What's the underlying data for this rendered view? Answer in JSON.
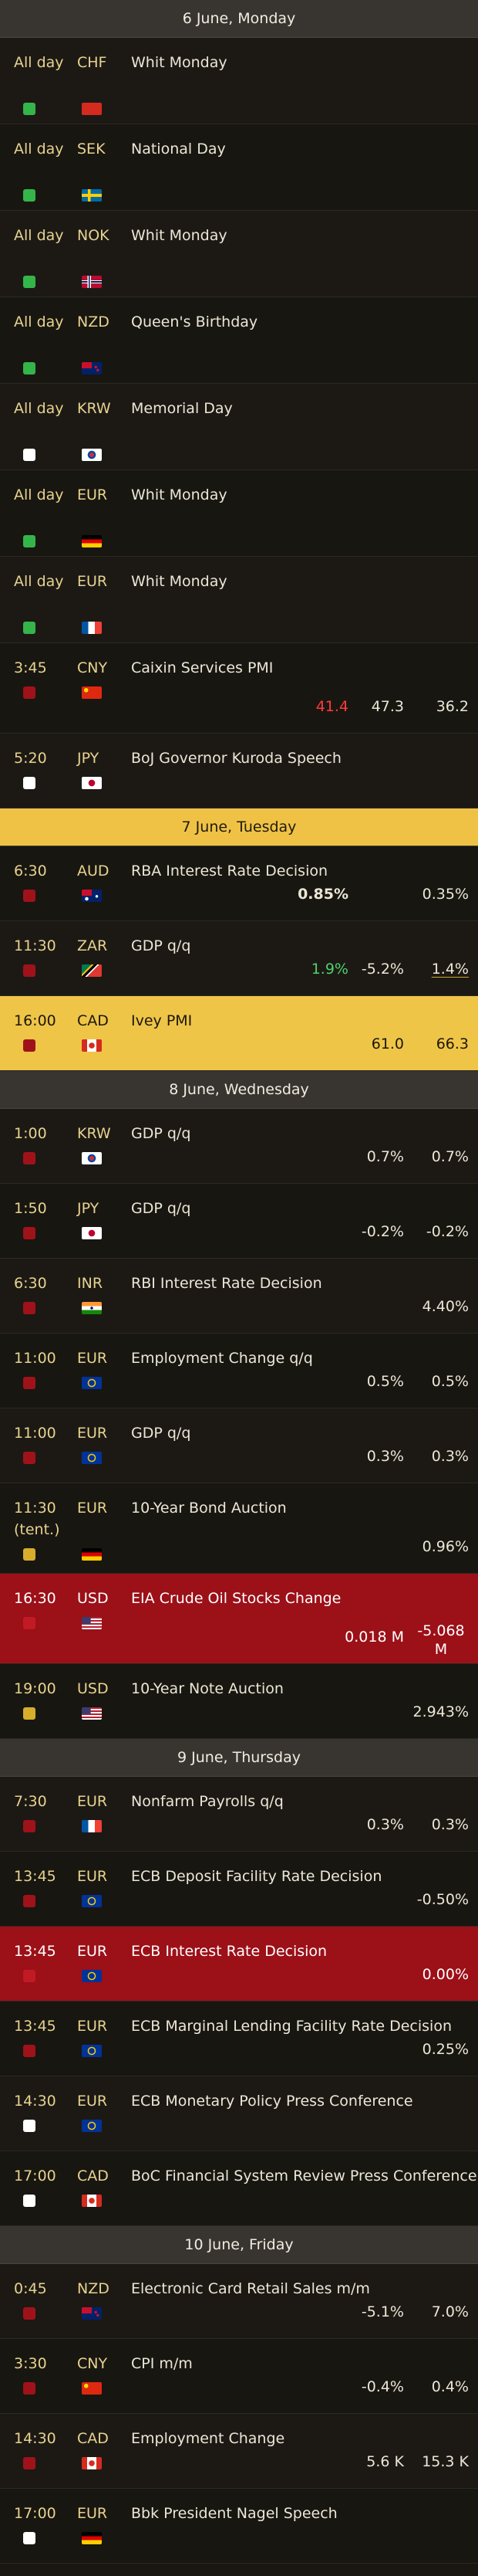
{
  "days": [
    {
      "label": "6 June, Monday",
      "highlight": false,
      "events": [
        {
          "time": "All day",
          "ccy": "CHF",
          "flag": "ch",
          "imp": "green",
          "title": "Whit Monday",
          "h": 111
        },
        {
          "time": "All day",
          "ccy": "SEK",
          "flag": "se",
          "imp": "green",
          "title": "National Day",
          "h": 111
        },
        {
          "time": "All day",
          "ccy": "NOK",
          "flag": "no",
          "imp": "green",
          "title": "Whit Monday",
          "h": 111
        },
        {
          "time": "All day",
          "ccy": "NZD",
          "flag": "nz",
          "imp": "green",
          "title": "Queen's Birthday",
          "h": 111
        },
        {
          "time": "All day",
          "ccy": "KRW",
          "flag": "kr",
          "imp": "white",
          "title": "Memorial Day",
          "h": 111
        },
        {
          "time": "All day",
          "ccy": "EUR",
          "flag": "de",
          "imp": "green",
          "title": "Whit Monday",
          "h": 111
        },
        {
          "time": "All day",
          "ccy": "EUR",
          "flag": "fr",
          "imp": "green",
          "title": "Whit Monday",
          "h": 111
        },
        {
          "time": "3:45",
          "ccy": "CNY",
          "flag": "cn",
          "imp": "red",
          "title": "Caixin Services PMI",
          "actual": "41.4",
          "actual_color": "neg",
          "forecast": "47.3",
          "previous": "36.2",
          "h": 116
        },
        {
          "time": "5:20",
          "ccy": "JPY",
          "flag": "jp",
          "imp": "white",
          "title": "BoJ Governor Kuroda Speech",
          "h": 96
        }
      ]
    },
    {
      "label": "7 June, Tuesday",
      "highlight": true,
      "events": [
        {
          "time": "6:30",
          "ccy": "AUD",
          "flag": "au",
          "imp": "red",
          "title": "RBA Interest Rate Decision",
          "actual": "0.85%",
          "actual_color": "bold",
          "previous": "0.35%",
          "h": 96
        },
        {
          "time": "11:30",
          "ccy": "ZAR",
          "flag": "za",
          "imp": "red",
          "title": "GDP q/q",
          "actual": "1.9%",
          "actual_color": "pos",
          "forecast": "-5.2%",
          "previous": "1.4%",
          "prev_und": true,
          "h": 96
        },
        {
          "time": "16:00",
          "ccy": "CAD",
          "flag": "ca",
          "imp": "red",
          "title": "Ivey PMI",
          "forecast": "61.0",
          "previous": "66.3",
          "row": "yellow",
          "h": 96
        }
      ]
    },
    {
      "label": "8 June, Wednesday",
      "highlight": false,
      "events": [
        {
          "time": "1:00",
          "ccy": "KRW",
          "flag": "kr",
          "imp": "red",
          "title": "GDP q/q",
          "forecast": "0.7%",
          "previous": "0.7%",
          "h": 96
        },
        {
          "time": "1:50",
          "ccy": "JPY",
          "flag": "jp",
          "imp": "red",
          "title": "GDP q/q",
          "forecast": "-0.2%",
          "previous": "-0.2%",
          "h": 96
        },
        {
          "time": "6:30",
          "ccy": "INR",
          "flag": "in",
          "imp": "red",
          "title": "RBI Interest Rate Decision",
          "previous": "4.40%",
          "h": 96
        },
        {
          "time": "11:00",
          "ccy": "EUR",
          "flag": "eu",
          "imp": "red",
          "title": "Employment Change q/q",
          "forecast": "0.5%",
          "previous": "0.5%",
          "h": 96
        },
        {
          "time": "11:00",
          "ccy": "EUR",
          "flag": "eu",
          "imp": "red",
          "title": "GDP q/q",
          "forecast": "0.3%",
          "previous": "0.3%",
          "h": 96
        },
        {
          "time": "11:30 (tent.)",
          "ccy": "EUR",
          "flag": "de",
          "imp": "yellow",
          "title": "10-Year Bond Auction",
          "previous": "0.96%",
          "h": 116
        },
        {
          "time": "16:30",
          "ccy": "USD",
          "flag": "us",
          "imp": "red",
          "title": "EIA Crude Oil Stocks Change",
          "forecast": "0.018 M",
          "previous": "-5.068 M",
          "row": "red",
          "h": 116
        },
        {
          "time": "19:00",
          "ccy": "USD",
          "flag": "us",
          "imp": "yellow",
          "title": "10-Year Note Auction",
          "previous": "2.943%",
          "h": 96
        }
      ]
    },
    {
      "label": "9 June, Thursday",
      "highlight": false,
      "events": [
        {
          "time": "7:30",
          "ccy": "EUR",
          "flag": "fr",
          "imp": "red",
          "title": "Nonfarm Payrolls q/q",
          "forecast": "0.3%",
          "previous": "0.3%",
          "h": 96
        },
        {
          "time": "13:45",
          "ccy": "EUR",
          "flag": "eu",
          "imp": "red",
          "title": "ECB Deposit Facility Rate Decision",
          "previous": "-0.50%",
          "h": 96
        },
        {
          "time": "13:45",
          "ccy": "EUR",
          "flag": "eu",
          "imp": "red",
          "title": "ECB Interest Rate Decision",
          "previous": "0.00%",
          "row": "red",
          "h": 96
        },
        {
          "time": "13:45",
          "ccy": "EUR",
          "flag": "eu",
          "imp": "red",
          "title": "ECB Marginal Lending Facility Rate Decision",
          "previous": "0.25%",
          "h": 96
        },
        {
          "time": "14:30",
          "ccy": "EUR",
          "flag": "eu",
          "imp": "white",
          "title": "ECB Monetary Policy Press Conference",
          "h": 96
        },
        {
          "time": "17:00",
          "ccy": "CAD",
          "flag": "ca",
          "imp": "white",
          "title": "BoC Financial System Review Press Conference",
          "h": 96
        }
      ]
    },
    {
      "label": "10 June, Friday",
      "highlight": false,
      "events": [
        {
          "time": "0:45",
          "ccy": "NZD",
          "flag": "nz",
          "imp": "red",
          "title": "Electronic Card Retail Sales m/m",
          "forecast": "-5.1%",
          "previous": "7.0%",
          "h": 96
        },
        {
          "time": "3:30",
          "ccy": "CNY",
          "flag": "cn",
          "imp": "red",
          "title": "CPI m/m",
          "forecast": "-0.4%",
          "previous": "0.4%",
          "h": 96
        },
        {
          "time": "14:30",
          "ccy": "CAD",
          "flag": "ca",
          "imp": "red",
          "title": "Employment Change",
          "forecast": "5.6 K",
          "previous": "15.3 K",
          "h": 96
        },
        {
          "time": "17:00",
          "ccy": "EUR",
          "flag": "de",
          "imp": "white",
          "title": "Bbk President Nagel Speech",
          "h": 96
        }
      ]
    }
  ],
  "colors": {
    "green": "#34b54a",
    "red": "#a0121a",
    "white": "#ffffff",
    "yellow": "#d7ad2c"
  }
}
